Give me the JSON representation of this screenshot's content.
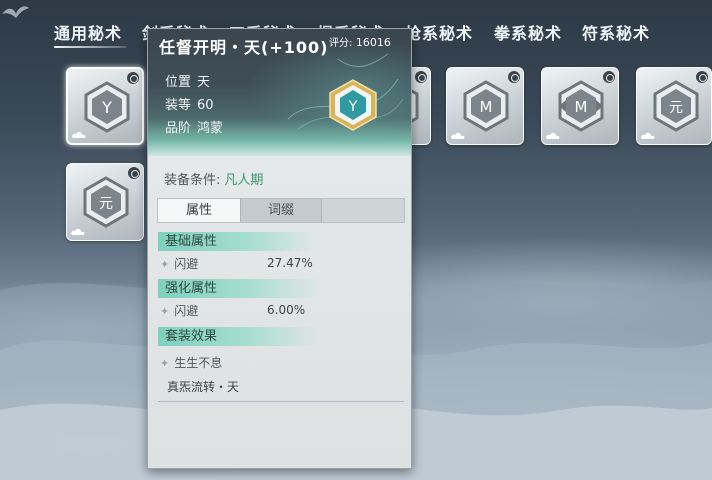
{
  "tabs": [
    {
      "label": "通用秘术",
      "active": true
    },
    {
      "label": "剑系秘术",
      "active": false
    },
    {
      "label": "刀系秘术",
      "active": false
    },
    {
      "label": "棍系秘术",
      "active": false
    },
    {
      "label": "枪系秘术",
      "active": false
    },
    {
      "label": "拳系秘术",
      "active": false
    },
    {
      "label": "符系秘术",
      "active": false
    }
  ],
  "slots": [
    {
      "glyph": "Y",
      "selected": true
    },
    {
      "glyph": "M",
      "selected": false
    },
    {
      "glyph": "M",
      "selected": false
    },
    {
      "glyph": "M",
      "selected": false
    },
    {
      "glyph": "元",
      "selected": false
    },
    {
      "glyph": "元",
      "selected": false
    }
  ],
  "tooltip": {
    "title": "任督开明・天(+100)",
    "score_label": "评分:",
    "score_value": "16016",
    "position_label": "位置",
    "position_value": "天",
    "level_label": "装等",
    "level_value": "60",
    "grade_label": "品阶",
    "grade_value": "鸿蒙",
    "gem_glyph": "Y",
    "requirement_label": "装备条件:",
    "requirement_value": "凡人期",
    "subtabs": [
      "属性",
      "词缀"
    ],
    "basic_section": "基础属性",
    "basic_attr_name": "闪避",
    "basic_attr_value": "27.47%",
    "enhance_section": "强化属性",
    "enhance_attr_name": "闪避",
    "enhance_attr_value": "6.00%",
    "set_section": "套装效果",
    "set_name": "生生不息",
    "set_piece": "真炁流转・天"
  }
}
